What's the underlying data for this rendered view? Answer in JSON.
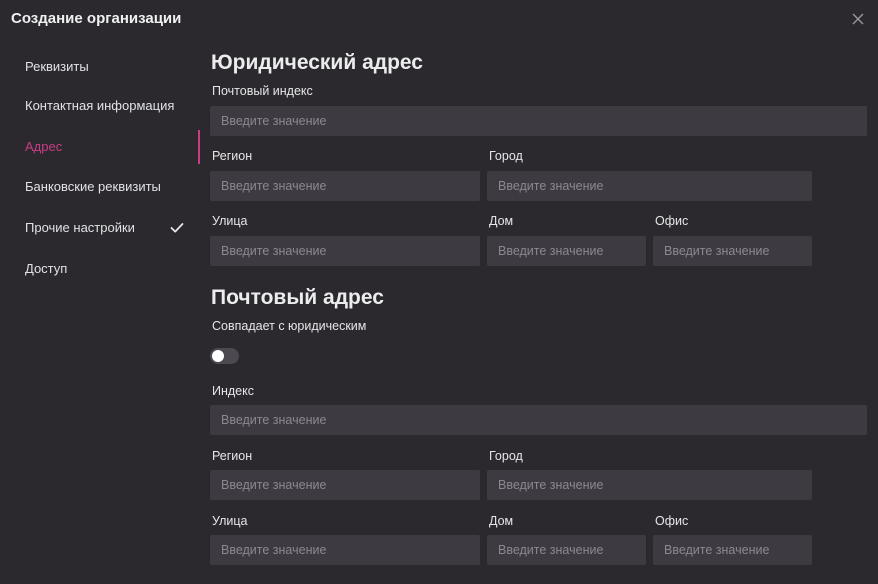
{
  "dialog": {
    "title": "Создание организации",
    "close_icon": "close-icon"
  },
  "sidebar": {
    "items": [
      {
        "label": "Реквизиты",
        "active": false,
        "checked": false
      },
      {
        "label": "Контактная информация",
        "active": false,
        "checked": false
      },
      {
        "label": "Адрес",
        "active": true,
        "checked": false
      },
      {
        "label": "Банковские реквизиты",
        "active": false,
        "checked": false
      },
      {
        "label": "Прочие настройки",
        "active": false,
        "checked": true
      },
      {
        "label": "Доступ",
        "active": false,
        "checked": false
      }
    ],
    "accent_color": "#c93d86"
  },
  "legal_address": {
    "title": "Юридический адрес",
    "postal_code": {
      "label": "Почтовый индекс",
      "placeholder": "Введите значение",
      "value": ""
    },
    "region": {
      "label": "Регион",
      "placeholder": "Введите значение",
      "value": ""
    },
    "city": {
      "label": "Город",
      "placeholder": "Введите значение",
      "value": ""
    },
    "street": {
      "label": "Улица",
      "placeholder": "Введите значение",
      "value": ""
    },
    "house": {
      "label": "Дом",
      "placeholder": "Введите значение",
      "value": ""
    },
    "office": {
      "label": "Офис",
      "placeholder": "Введите значение",
      "value": ""
    }
  },
  "postal_address": {
    "title": "Почтовый адрес",
    "same_as_legal": {
      "label": "Совпадает с юридическим",
      "enabled": false
    },
    "index": {
      "label": "Индекс",
      "placeholder": "Введите значение",
      "value": ""
    },
    "region": {
      "label": "Регион",
      "placeholder": "Введите значение",
      "value": ""
    },
    "city": {
      "label": "Город",
      "placeholder": "Введите значение",
      "value": ""
    },
    "street": {
      "label": "Улица",
      "placeholder": "Введите значение",
      "value": ""
    },
    "house": {
      "label": "Дом",
      "placeholder": "Введите значение",
      "value": ""
    },
    "office": {
      "label": "Офис",
      "placeholder": "Введите значение",
      "value": ""
    }
  }
}
